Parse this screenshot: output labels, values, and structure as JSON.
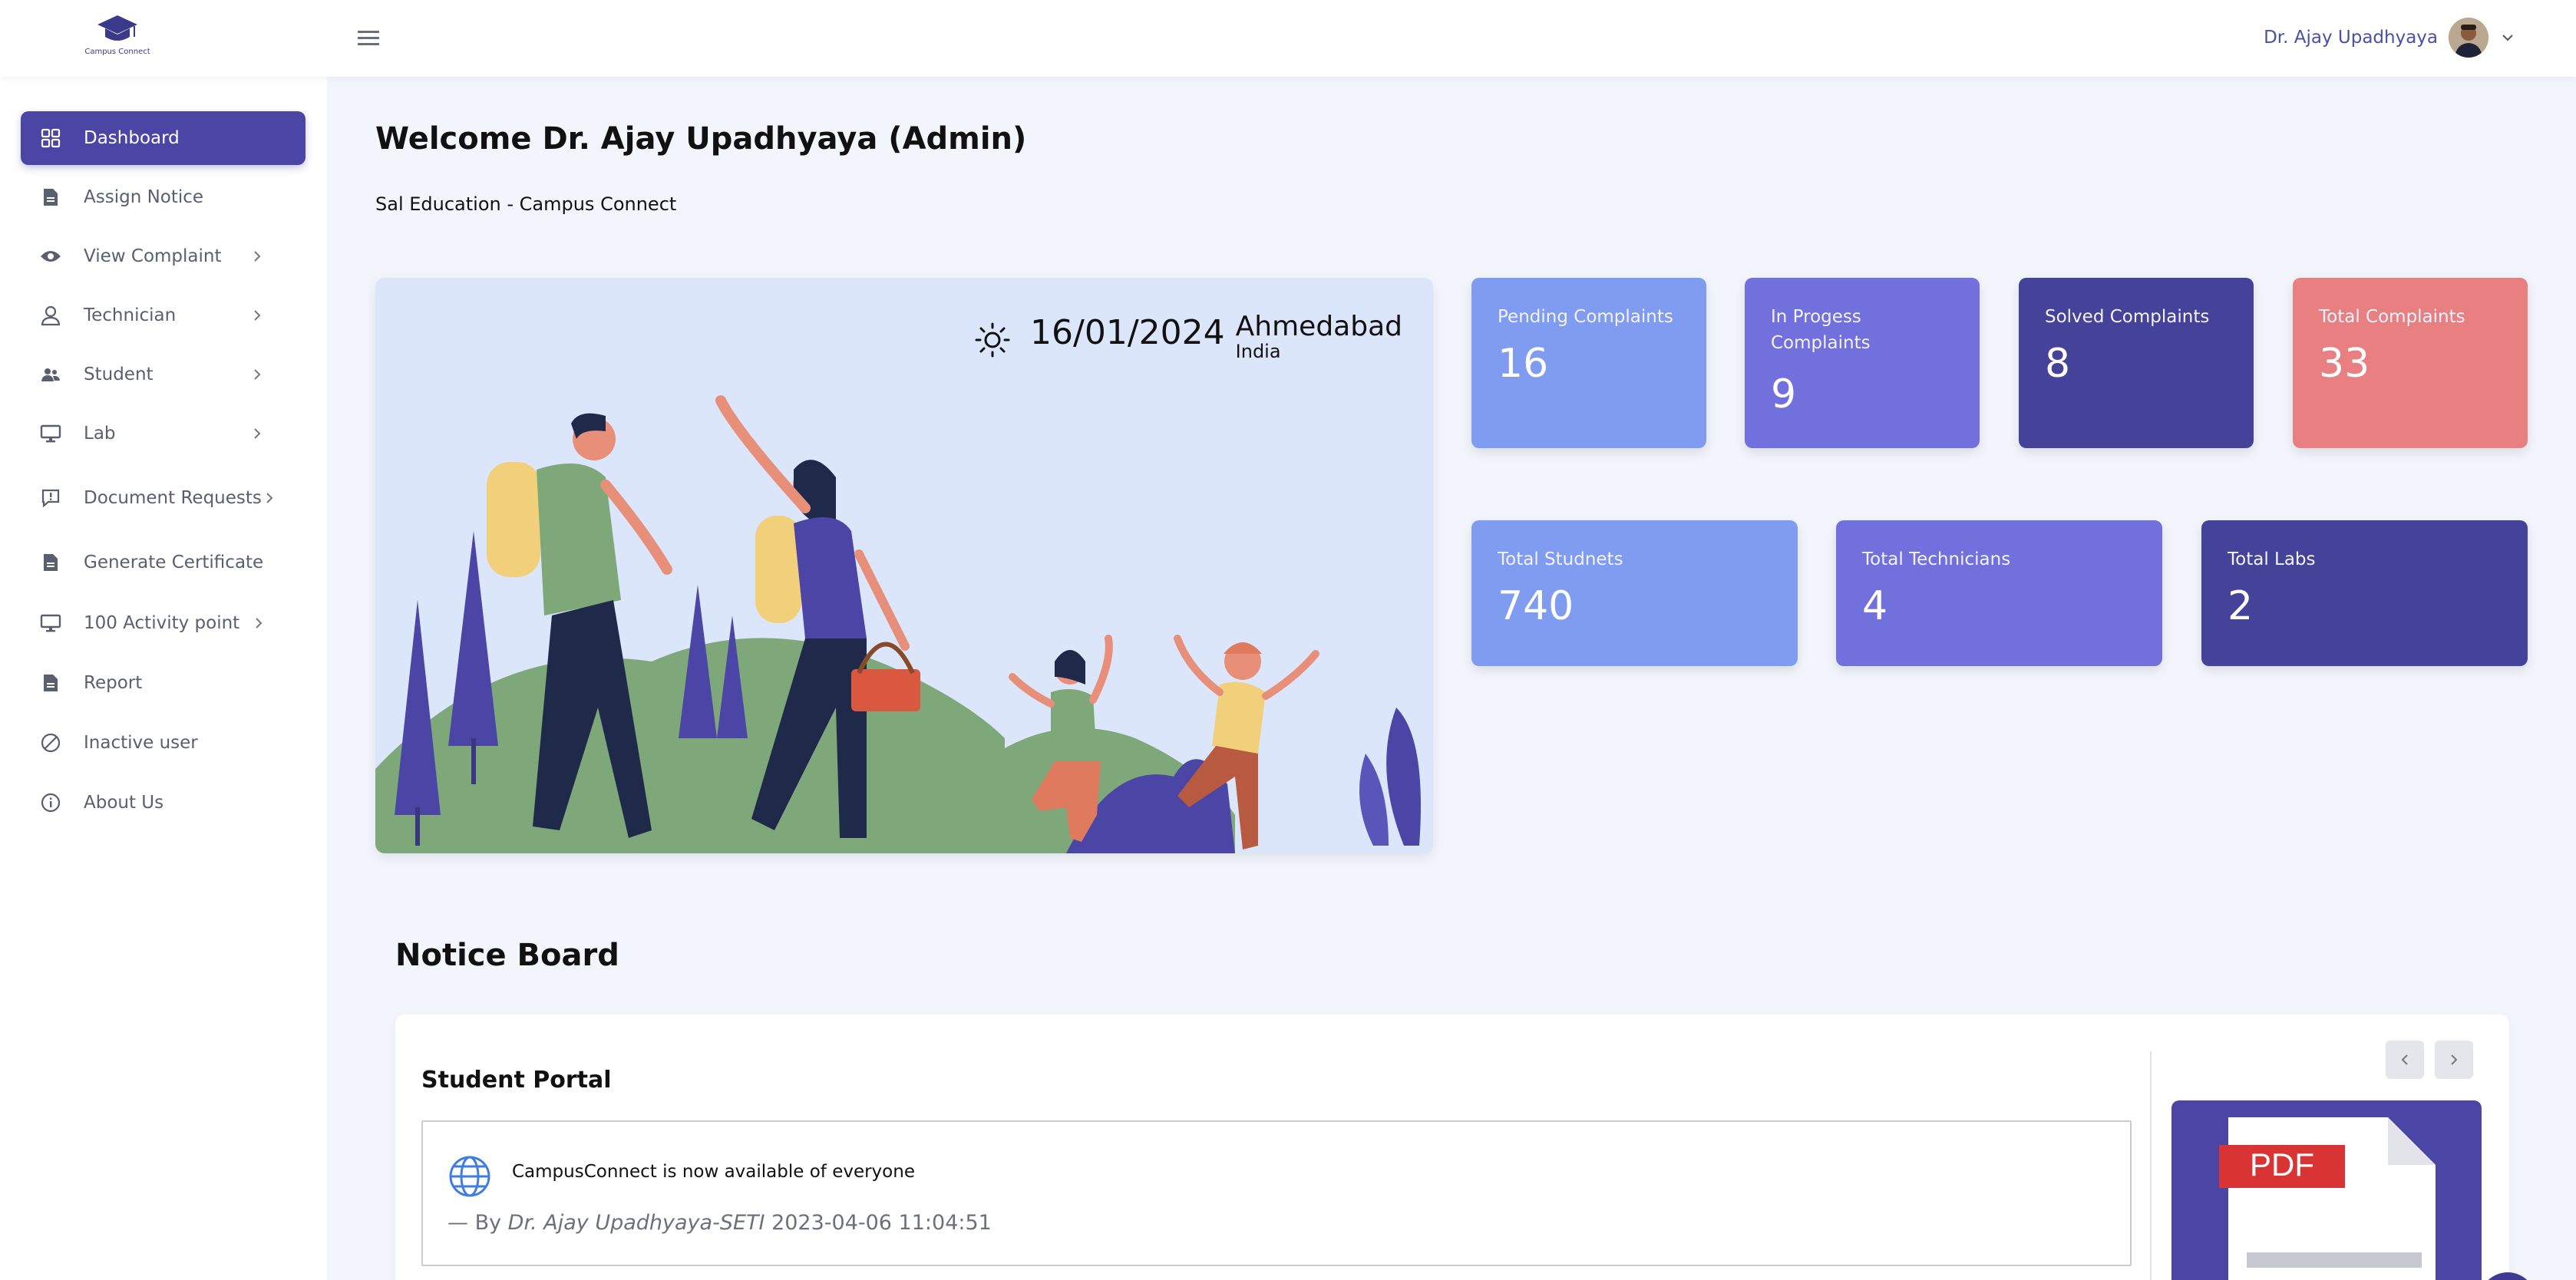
{
  "header": {
    "logo_text": "Campus Connect",
    "user_name": "Dr. Ajay Upadhyaya"
  },
  "sidebar": {
    "items": [
      {
        "label": "Dashboard",
        "icon": "grid-icon",
        "active": true
      },
      {
        "label": "Assign Notice",
        "icon": "document-icon"
      },
      {
        "label": "View Complaint",
        "icon": "eye-icon",
        "has_submenu": true
      },
      {
        "label": "Technician",
        "icon": "user-icon",
        "has_submenu": true
      },
      {
        "label": "Student",
        "icon": "users-icon",
        "has_submenu": true
      },
      {
        "label": "Lab",
        "icon": "monitor-icon",
        "has_submenu": true
      },
      {
        "label": "Document Requests",
        "icon": "chat-alert-icon",
        "has_submenu": true
      },
      {
        "label": "Generate Certificate",
        "icon": "document-icon"
      },
      {
        "label": "100 Activity point",
        "icon": "monitor-icon",
        "has_submenu": true
      },
      {
        "label": "Report",
        "icon": "document-icon"
      },
      {
        "label": "Inactive user",
        "icon": "ban-icon"
      },
      {
        "label": "About Us",
        "icon": "info-icon"
      }
    ]
  },
  "main": {
    "welcome": "Welcome Dr. Ajay Upadhyaya (Admin)",
    "subtitle": "Sal Education - Campus Connect",
    "weather": {
      "icon": "sun-icon",
      "date": "16/01/2024",
      "city": "Ahmedabad",
      "country": "India"
    },
    "stats_top": [
      {
        "label": "Pending Complaints",
        "value": "16",
        "color": "#7f9cf0"
      },
      {
        "label": "In Progess Complaints",
        "value": "9",
        "color": "#7270dc"
      },
      {
        "label": "Solved Complaints",
        "value": "8",
        "color": "#45429a"
      },
      {
        "label": "Total Complaints",
        "value": "33",
        "color": "#e87f80"
      }
    ],
    "stats_bottom": [
      {
        "label": "Total Studnets",
        "value": "740",
        "color": "#7f9cf0"
      },
      {
        "label": "Total Technicians",
        "value": "4",
        "color": "#7270dc"
      },
      {
        "label": "Total Labs",
        "value": "2",
        "color": "#45429a"
      }
    ],
    "notice_board": {
      "title": "Notice Board",
      "portal_title": "Student Portal",
      "notice_text": "CampusConnect is now available of everyone",
      "meta_prefix": "— By ",
      "meta_author": "Dr. Ajay Upadhyaya-SETI",
      "meta_time": " 2023-04-06 11:04:51",
      "pdf_label": "PDF"
    }
  },
  "colors": {
    "accent": "#4b45a6",
    "background": "#f2f5fc",
    "hero_bg": "#dbe6fb"
  }
}
